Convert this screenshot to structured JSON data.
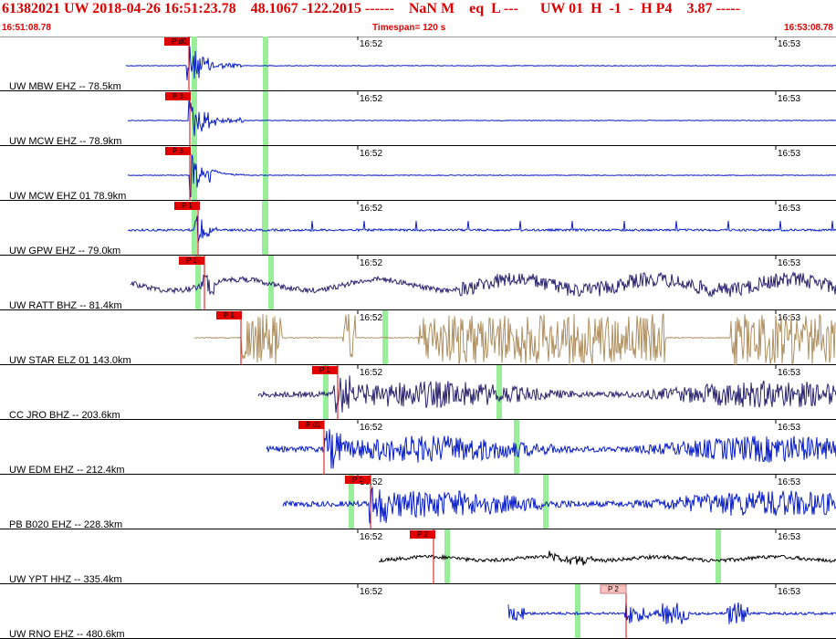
{
  "header": {
    "title": "61382021 UW 2018-04-26 16:51:23.78    48.1067 -122.2015 ------    NaN M    eq  L ---      UW 01  H  -1  -  H P4    3.87 -----",
    "start_time": "16:51:08.78",
    "timespan": "Timespan= 120 s",
    "end_time": "16:53:08.78"
  },
  "time_marks": [
    "16:52",
    "16:53"
  ],
  "colors": {
    "pick_box": "#e00000",
    "pick_box_light": "#ffc0c0",
    "pick_line": "#e00000",
    "marker": "#99ee99",
    "separator": "#000000"
  },
  "channels": [
    {
      "label": "UW MBW EHZ -- 78.5km",
      "pick": "P d0",
      "trace_color": "#0a1ec8",
      "style": "flat"
    },
    {
      "label": "UW MCW EHZ -- 78.9km",
      "pick": "P 3",
      "trace_color": "#0a1ec8",
      "style": "flat"
    },
    {
      "label": "UW MCW EHZ 01 78.9km",
      "pick": "P 3",
      "trace_color": "#0a1ec8",
      "style": "flat"
    },
    {
      "label": "UW GPW EHZ -- 79.0km",
      "pick": "P 1",
      "trace_color": "#0a1ec8",
      "style": "spiky"
    },
    {
      "label": "UW RATT BHZ -- 81.4km",
      "pick": "P 1",
      "trace_color": "#2a2470",
      "style": "wavy"
    },
    {
      "label": "UW STAR ELZ 01 143.0km",
      "pick": "P 1",
      "trace_color": "#b09060",
      "style": "clipped"
    },
    {
      "label": "CC JRO BHZ -- 203.6km",
      "pick": "P 1",
      "trace_color": "#2a2470",
      "style": "noisy"
    },
    {
      "label": "UW EDM EHZ -- 212.4km",
      "pick": "P d1",
      "trace_color": "#0a1ec8",
      "style": "noisy"
    },
    {
      "label": "PB B020 EHZ -- 228.3km",
      "pick": "P 1",
      "trace_color": "#0a1ec8",
      "style": "noisy"
    },
    {
      "label": "UW YPT HHZ -- 335.4km",
      "pick": "P 2",
      "trace_color": "#000000",
      "style": "quiet"
    },
    {
      "label": "UW RNO EHZ -- 480.6km",
      "pick": "P 2",
      "trace_color": "#0a1ec8",
      "style": "bursts"
    }
  ]
}
